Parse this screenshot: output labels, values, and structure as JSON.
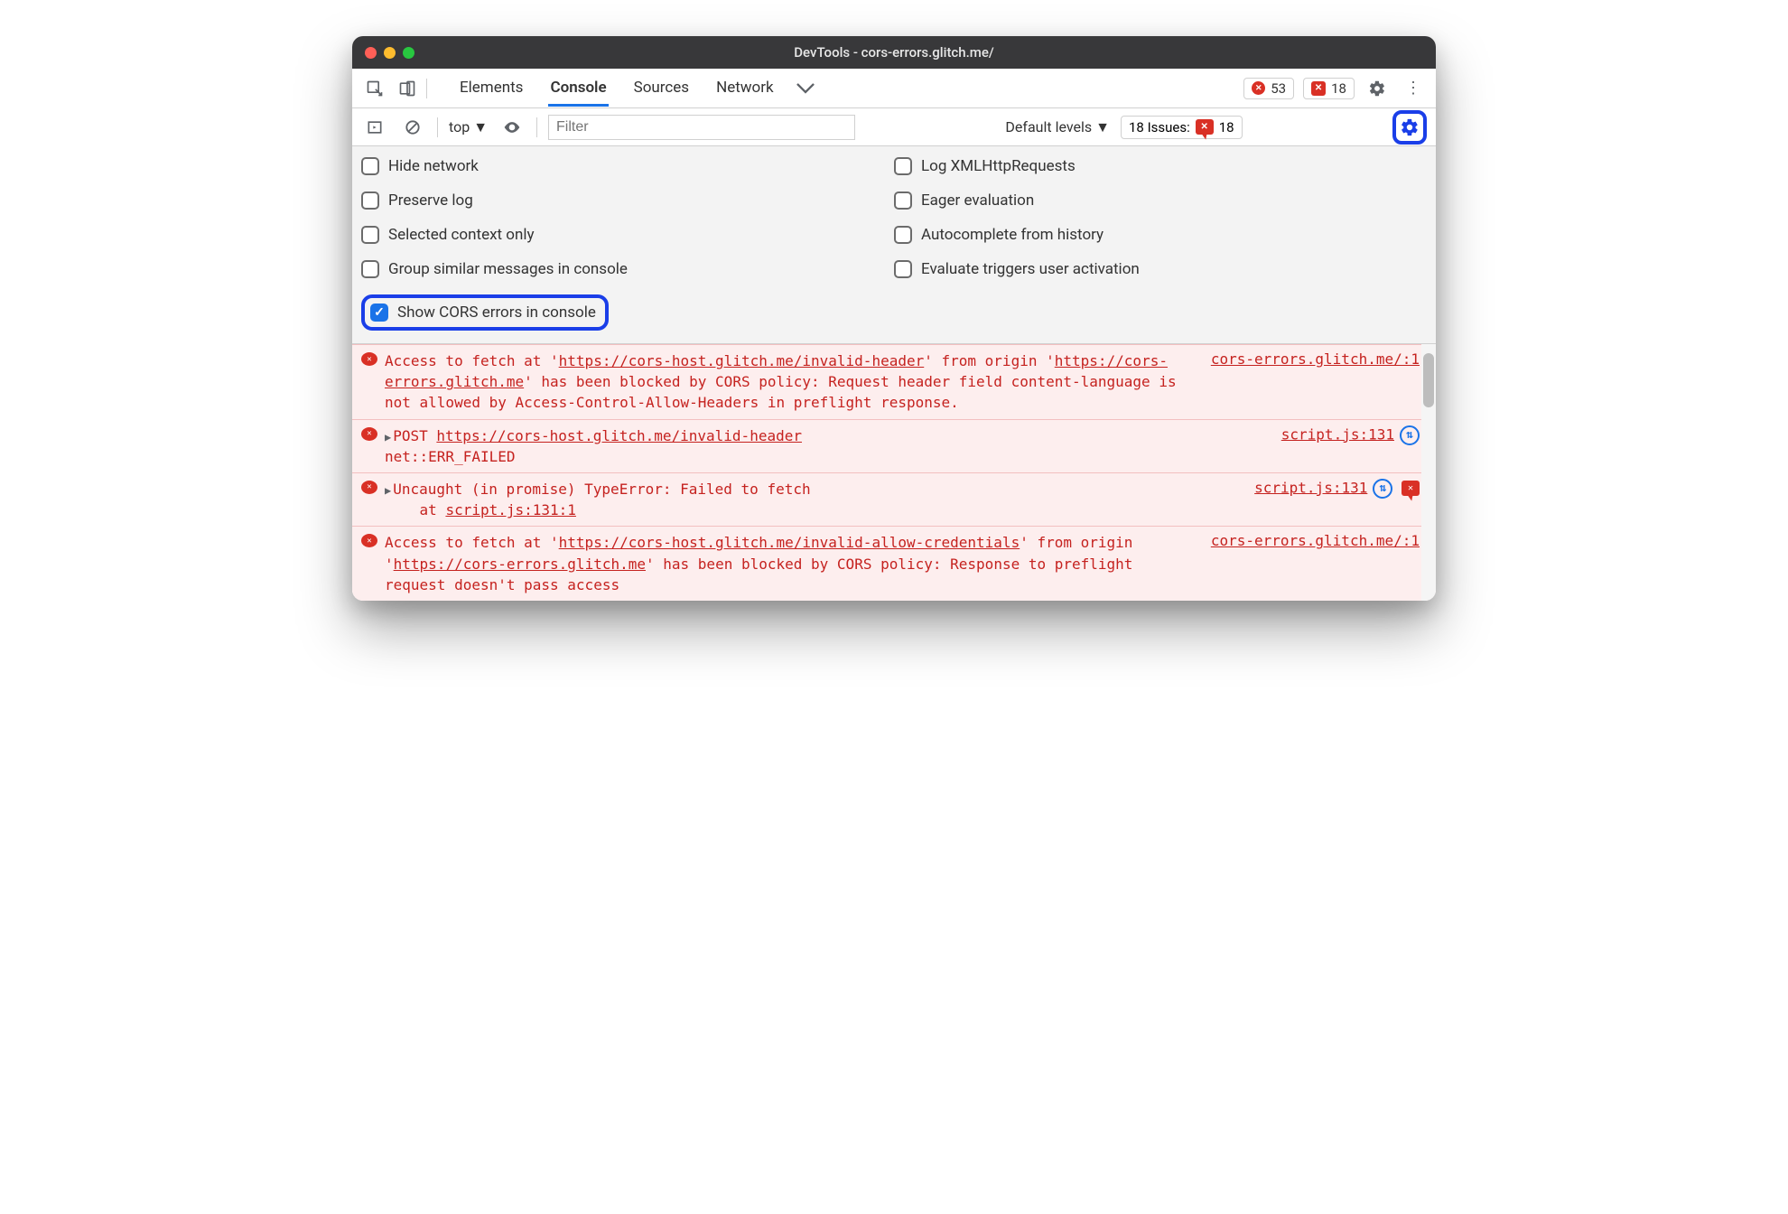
{
  "window": {
    "title": "DevTools - cors-errors.glitch.me/"
  },
  "tabs": {
    "items": [
      "Elements",
      "Console",
      "Sources",
      "Network"
    ],
    "active": "Console"
  },
  "counters": {
    "errors": "53",
    "issues_top": "18"
  },
  "subbar": {
    "context": "top",
    "filter_placeholder": "Filter",
    "levels": "Default levels",
    "issues_label": "18 Issues:",
    "issues_count": "18"
  },
  "settings": {
    "left": [
      {
        "label": "Hide network",
        "checked": false
      },
      {
        "label": "Preserve log",
        "checked": false
      },
      {
        "label": "Selected context only",
        "checked": false
      },
      {
        "label": "Group similar messages in console",
        "checked": false
      },
      {
        "label": "Show CORS errors in console",
        "checked": true,
        "highlight": true
      }
    ],
    "right": [
      {
        "label": "Log XMLHttpRequests",
        "checked": false
      },
      {
        "label": "Eager evaluation",
        "checked": false
      },
      {
        "label": "Autocomplete from history",
        "checked": false
      },
      {
        "label": "Evaluate triggers user activation",
        "checked": false
      }
    ]
  },
  "logs": [
    {
      "msg_pre": "Access to fetch at '",
      "url1": "https://cors-host.glitch.me/invalid-header",
      "mid1": "' from origin '",
      "url2": "https://cors-errors.glitch.me",
      "tail": "' has been blocked by CORS policy: Request header field content-language is not allowed by Access-Control-Allow-Headers in preflight response.",
      "src": "cors-errors.glitch.me/:1"
    },
    {
      "prefix": "POST",
      "url": "https://cors-host.glitch.me/invalid-header",
      "tail": "net::ERR_FAILED",
      "src": "script.js:131",
      "sync": true
    },
    {
      "msg": "Uncaught (in promise) TypeError: Failed to fetch",
      "stack_label": "at",
      "stack_loc": "script.js:131:1",
      "src": "script.js:131",
      "sync": true,
      "chat": true
    },
    {
      "msg_pre": "Access to fetch at '",
      "url1": "https://cors-host.glitch.me/invalid-allow-credentials",
      "mid1": "' from origin '",
      "url2": "https://cors-errors.glitch.me",
      "tail": "' has been blocked by CORS policy: Response to preflight request doesn't pass access",
      "src": "cors-errors.glitch.me/:1"
    }
  ]
}
